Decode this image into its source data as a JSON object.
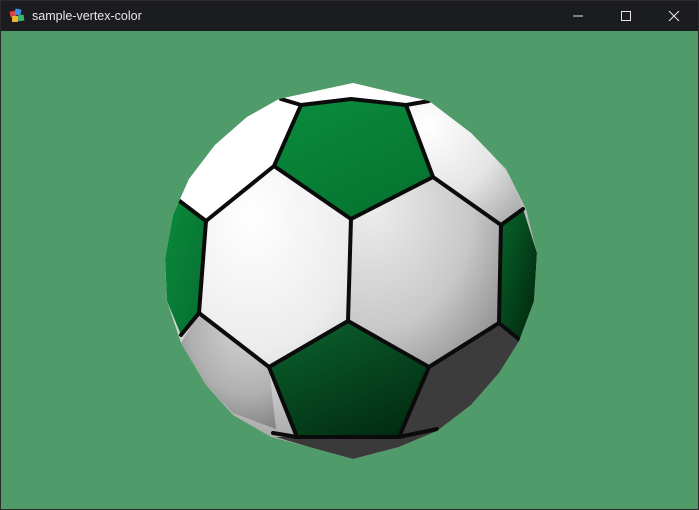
{
  "window": {
    "title": "sample-vertex-color",
    "app_icon": "app-logo-icon",
    "controls": {
      "minimize_icon": "minimize-icon",
      "maximize_icon": "maximize-icon",
      "close_icon": "close-icon"
    }
  },
  "scene": {
    "background_color": "#4f9b69",
    "object": "soccer-ball",
    "patch_colors": {
      "white": "#f2f2f2",
      "green": "#06833a",
      "seam": "#0b0b0b"
    }
  }
}
